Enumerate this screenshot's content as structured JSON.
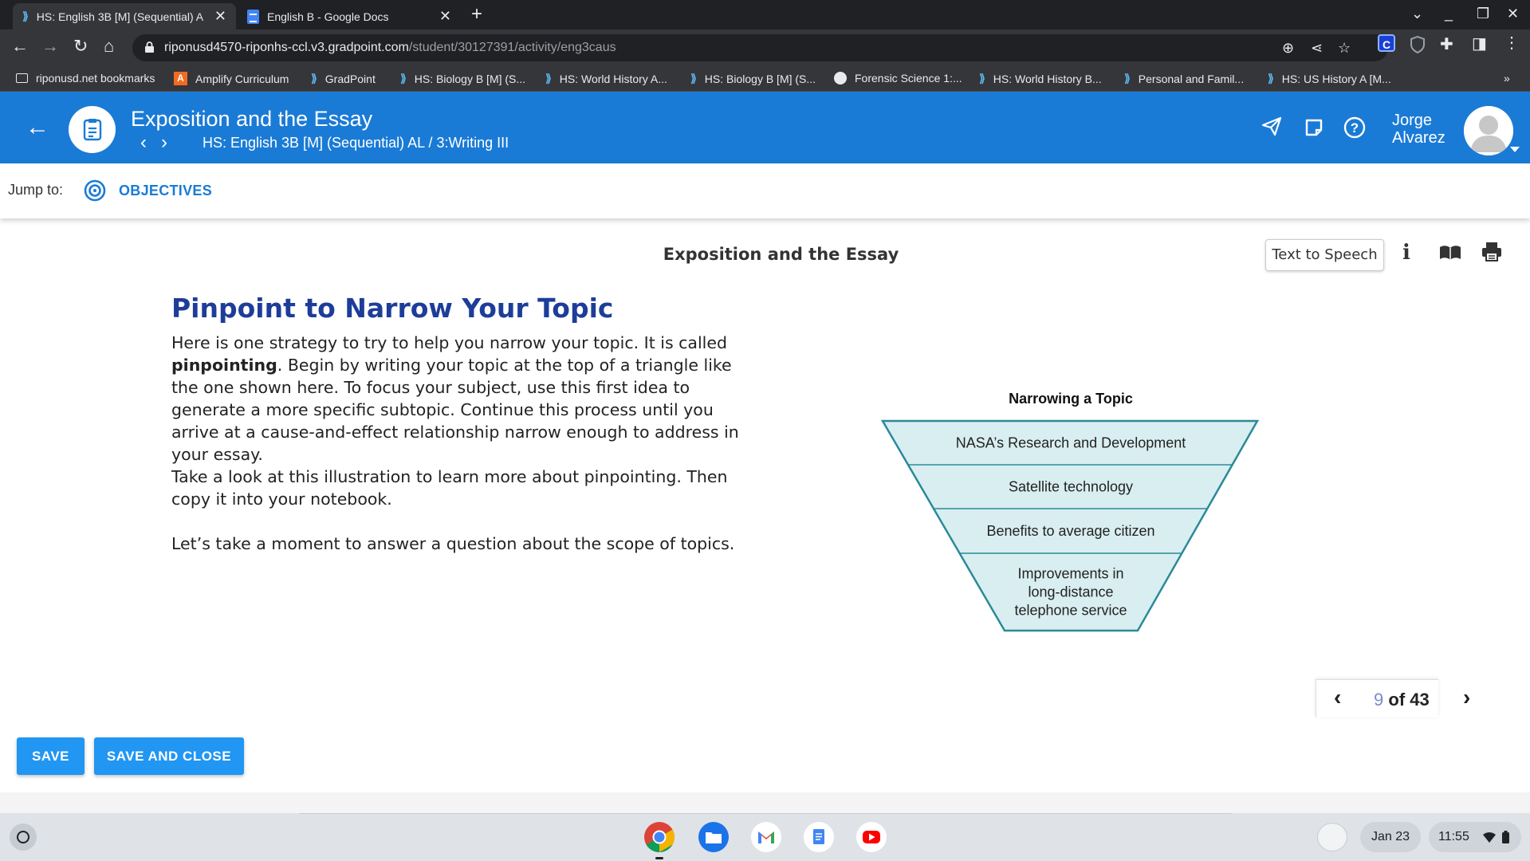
{
  "browser": {
    "tabs": [
      {
        "title": "HS: English 3B [M] (Sequential) A",
        "icon": "gradpoint-icon",
        "active": true
      },
      {
        "title": "English B - Google Docs",
        "icon": "google-docs-icon",
        "active": false
      }
    ],
    "url_host": "riponusd4570-riponhs-ccl.v3.gradpoint.com",
    "url_path": "/student/30127391/activity/eng3caus",
    "bookmarks": [
      {
        "label": "riponusd.net bookmarks",
        "icon": "folder-icon"
      },
      {
        "label": "Amplify Curriculum",
        "icon": "amplify-icon"
      },
      {
        "label": "GradPoint",
        "icon": "gradpoint-icon"
      },
      {
        "label": "HS: Biology B [M] (S...",
        "icon": "gradpoint-icon"
      },
      {
        "label": "HS: World History A...",
        "icon": "gradpoint-icon"
      },
      {
        "label": "HS: Biology B [M] (S...",
        "icon": "gradpoint-icon"
      },
      {
        "label": "Forensic Science 1:...",
        "icon": "globe-icon"
      },
      {
        "label": "HS: World History B...",
        "icon": "gradpoint-icon"
      },
      {
        "label": "Personal and Famil...",
        "icon": "gradpoint-icon"
      },
      {
        "label": "HS: US History A [M...",
        "icon": "gradpoint-icon"
      }
    ],
    "bookmarks_overflow": "»"
  },
  "header": {
    "activity_title": "Exposition and the Essay",
    "breadcrumb": "HS: English 3B [M] (Sequential) AL / 3:Writing III",
    "user_first": "Jorge",
    "user_last": "Alvarez"
  },
  "jump": {
    "label": "Jump to:",
    "objectives": "OBJECTIVES"
  },
  "content": {
    "page_title": "Exposition and the Essay",
    "tts_label": "Text to Speech",
    "info_glyph": "i",
    "heading": "Pinpoint to Narrow Your Topic",
    "p1_a": "Here is one strategy to try to help you narrow your topic. It is called ",
    "p1_bold": "pinpointing",
    "p1_b": ". Begin by writing your topic at the top of a triangle like the one shown here. To focus your subject, use this first idea to generate a more specific subtopic. Continue this process until you arrive at a cause-and-effect relationship narrow enough to address in your essay.",
    "p2": "Take a look at this illustration to learn more about pinpointing. Then copy it into your notebook.",
    "p3": "Let’s take a moment to answer a question about the scope of topics."
  },
  "diagram": {
    "title": "Narrowing a Topic",
    "levels": [
      [
        "NASA’s Research and Development"
      ],
      [
        "Satellite technology"
      ],
      [
        "Benefits to average citizen"
      ],
      [
        "Improvements in",
        "long-distance",
        "telephone service"
      ]
    ],
    "fill": "#d9eef0",
    "stroke": "#2a8a99"
  },
  "pager": {
    "current": "9",
    "of_total": "of 43"
  },
  "buttons": {
    "save": "SAVE",
    "save_close": "SAVE AND CLOSE"
  },
  "shelf": {
    "apps": [
      "chrome-icon",
      "files-icon",
      "gmail-icon",
      "docs-icon",
      "youtube-icon"
    ],
    "date": "Jan 23",
    "time": "11:55"
  },
  "colors": {
    "brand_blue": "#1a7bd6",
    "heading_blue": "#1d3d99",
    "button_blue": "#2196f3"
  }
}
